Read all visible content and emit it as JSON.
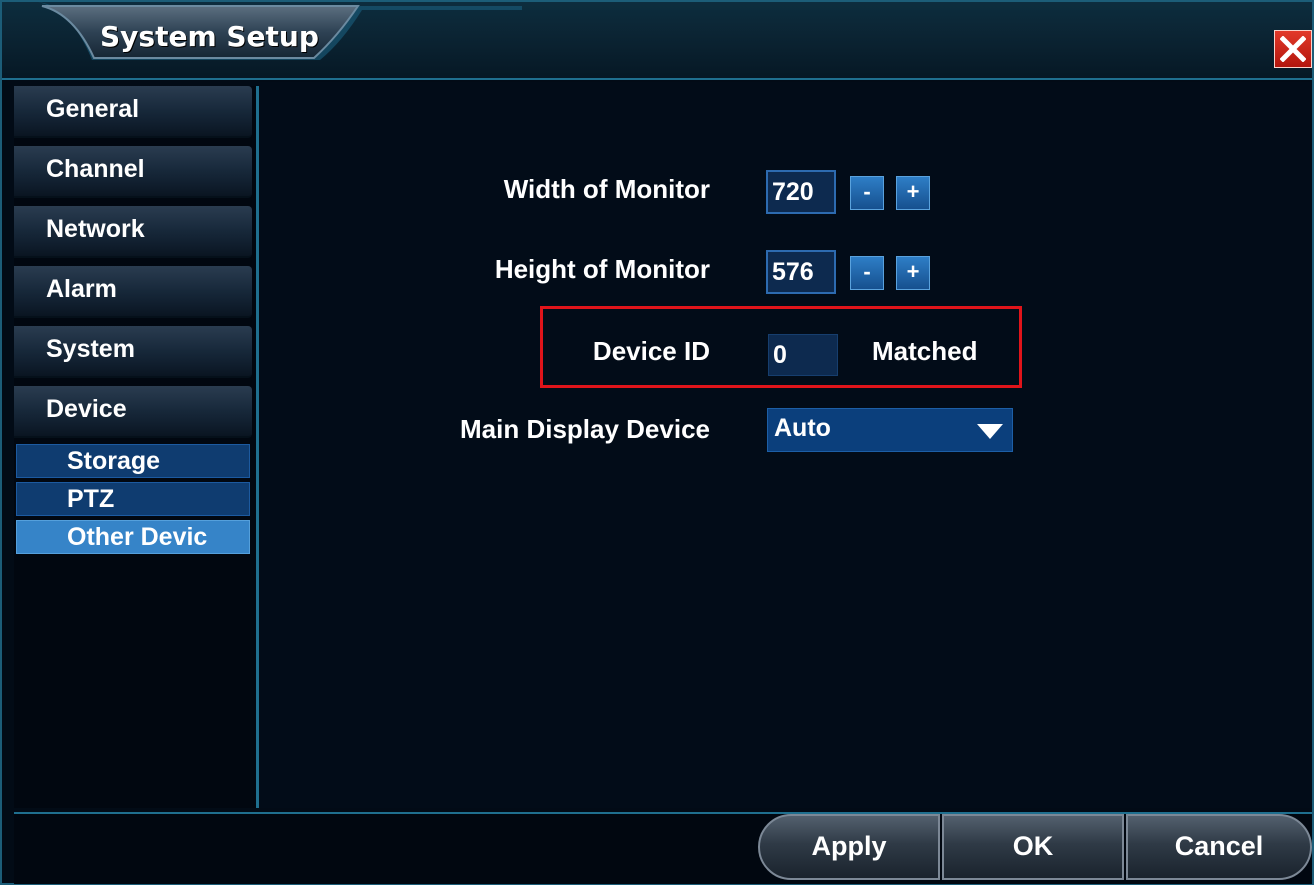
{
  "window": {
    "title": "System Setup",
    "close_icon": "close-icon"
  },
  "sidebar": {
    "items": [
      {
        "label": "General"
      },
      {
        "label": "Channel"
      },
      {
        "label": "Network"
      },
      {
        "label": "Alarm"
      },
      {
        "label": "System"
      },
      {
        "label": "Device"
      }
    ],
    "sub_items": [
      {
        "label": "Storage"
      },
      {
        "label": "PTZ"
      },
      {
        "label": "Other Devic"
      }
    ],
    "active_sub_item": "Other Devic"
  },
  "form": {
    "width_label": "Width of Monitor",
    "width_value": "720",
    "height_label": "Height of Monitor",
    "height_value": "576",
    "minus": "-",
    "plus": "+",
    "device_id_label": "Device ID",
    "device_id_value": "0",
    "device_id_status": "Matched",
    "display_label": "Main Display Device",
    "display_value": "Auto"
  },
  "footer": {
    "apply": "Apply",
    "ok": "OK",
    "cancel": "Cancel"
  },
  "colors": {
    "accent": "#1f6f8f",
    "highlight": "#e0141a",
    "active_sub": "#3684c8",
    "close": "#c8201a"
  }
}
